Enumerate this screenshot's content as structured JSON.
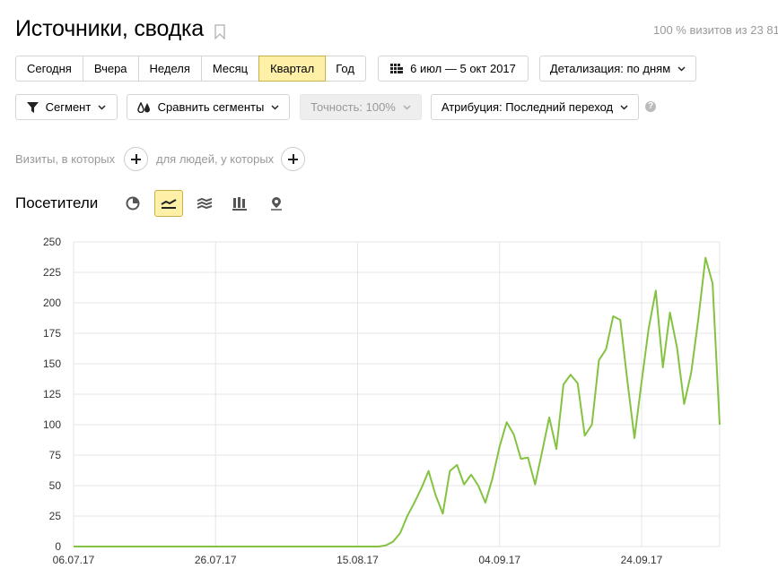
{
  "header": {
    "title": "Источники, сводка",
    "visits_info": "100 % визитов из 23 81"
  },
  "periods": [
    {
      "label": "Сегодня",
      "active": false
    },
    {
      "label": "Вчера",
      "active": false
    },
    {
      "label": "Неделя",
      "active": false
    },
    {
      "label": "Месяц",
      "active": false
    },
    {
      "label": "Квартал",
      "active": true
    },
    {
      "label": "Год",
      "active": false
    }
  ],
  "date_range": "6 июл — 5 окт 2017",
  "detail": "Детализация: по дням",
  "toolbar": {
    "segment": "Сегмент",
    "compare": "Сравнить сегменты",
    "accuracy": "Точность: 100%",
    "attribution": "Атрибуция: Последний переход",
    "help": "?"
  },
  "filters": {
    "visits_label": "Визиты, в которых",
    "people_label": "для людей, у которых"
  },
  "chart_section": {
    "title": "Посетители",
    "types": [
      "pie-chart-icon",
      "line-chart-icon",
      "area-chart-icon",
      "bar-chart-icon",
      "map-icon"
    ],
    "active_type": "line-chart-icon"
  },
  "colors": {
    "series": "#84c341",
    "accent": "#fff0a8",
    "holiday_tick": "#c0392b"
  },
  "chart_data": {
    "type": "line",
    "title": "",
    "xlabel": "",
    "ylabel": "",
    "ylim": [
      0,
      250
    ],
    "yticks": [
      0,
      25,
      50,
      75,
      100,
      125,
      150,
      175,
      200,
      225,
      250
    ],
    "xticks": [
      {
        "label": "06.07.17",
        "day": 0,
        "highlight": false
      },
      {
        "label": "26.07.17",
        "day": 20,
        "highlight": false
      },
      {
        "label": "15.08.17",
        "day": 40,
        "highlight": false
      },
      {
        "label": "04.09.17",
        "day": 60,
        "highlight": false
      },
      {
        "label": "24.09.17",
        "day": 80,
        "highlight": true
      }
    ],
    "series": [
      {
        "values": [
          0,
          0,
          0,
          0,
          0,
          0,
          0,
          0,
          0,
          0,
          0,
          0,
          0,
          0,
          0,
          0,
          0,
          0,
          0,
          0,
          0,
          0,
          0,
          0,
          0,
          0,
          0,
          0,
          0,
          0,
          0,
          0,
          0,
          0,
          0,
          0,
          0,
          0,
          0,
          0,
          0,
          0,
          0,
          0,
          1,
          4,
          11,
          25,
          36,
          48,
          62,
          42,
          27,
          62,
          67,
          51,
          59,
          50,
          36,
          56,
          82,
          102,
          92,
          72,
          73,
          51,
          78,
          106,
          80,
          133,
          141,
          134,
          91,
          100,
          153,
          162,
          189,
          186,
          136,
          89,
          135,
          179,
          210,
          147,
          192,
          163,
          117,
          143,
          187,
          237,
          216,
          100
        ]
      }
    ]
  }
}
